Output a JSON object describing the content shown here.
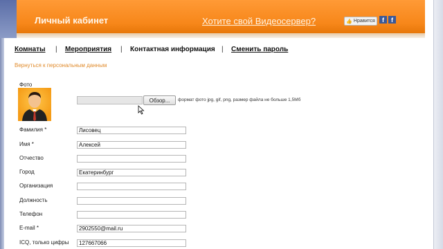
{
  "header": {
    "title": "Личный кабинет",
    "promo_link": "Хотите свой Видеосервер?",
    "like_label": "Нравится",
    "fb_icon": "f"
  },
  "nav": {
    "items": [
      {
        "label": "Комнаты",
        "active": false
      },
      {
        "label": "Мероприятия",
        "active": false
      },
      {
        "label": "Контактная информация",
        "active": true
      },
      {
        "label": "Сменить пароль",
        "active": false
      }
    ],
    "separator": "|"
  },
  "back_link": "Вернуться к персональным данным",
  "photo": {
    "label": "Фото",
    "browse_label": "Обзор...",
    "hint": "формат фото jpg, gif, png, размер файла не больше 1,5Мб"
  },
  "fields": [
    {
      "label": "Фамилия *",
      "value": "Лисовец"
    },
    {
      "label": "Имя *",
      "value": "Алексей"
    },
    {
      "label": "Отчество",
      "value": ""
    },
    {
      "label": "Город",
      "value": "Екатеринбург"
    },
    {
      "label": "Организация",
      "value": ""
    },
    {
      "label": "Должность",
      "value": ""
    },
    {
      "label": "Телефон",
      "value": ""
    },
    {
      "label": "E-mail *",
      "value": "2902550@mail.ru"
    },
    {
      "label": "ICQ, только цифры",
      "value": "127667066"
    }
  ],
  "colors": {
    "header_orange": "#f7871a",
    "link_orange": "#e08a2a",
    "fb_blue": "#3b5998"
  }
}
